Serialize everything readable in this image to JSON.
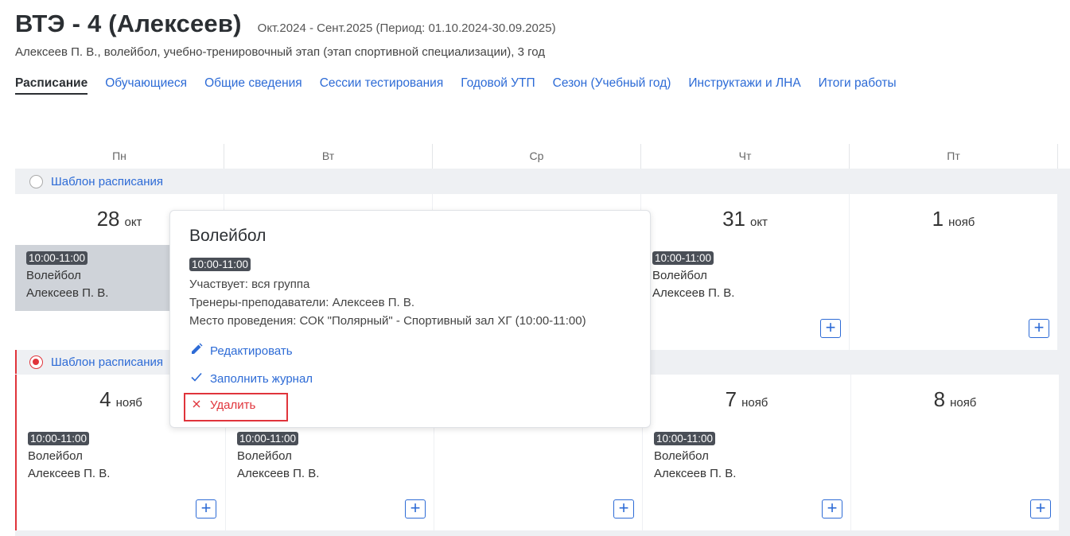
{
  "header": {
    "title": "ВТЭ - 4 (Алексеев)",
    "period": "Окт.2024 - Сент.2025 (Период: 01.10.2024-30.09.2025)",
    "subtitle": "Алексеев П. В., волейбол, учебно-тренировочный этап (этап спортивной специализации), 3 год"
  },
  "tabs": [
    {
      "label": "Расписание",
      "active": true
    },
    {
      "label": "Обучающиеся"
    },
    {
      "label": "Общие сведения"
    },
    {
      "label": "Сессии тестирования"
    },
    {
      "label": "Годовой УТП"
    },
    {
      "label": "Сезон (Учебный год)"
    },
    {
      "label": "Инструктажи и ЛНА"
    },
    {
      "label": "Итоги работы"
    }
  ],
  "calendar": {
    "days_of_week": [
      "Пн",
      "Вт",
      "Ср",
      "Чт",
      "Пт"
    ],
    "weeks": [
      {
        "template_label": "Шаблон расписания",
        "days": [
          {
            "num": "28",
            "mon": "окт",
            "event": {
              "time": "10:00-11:00",
              "title": "Волейбол",
              "coach": "Алексеев П. В."
            }
          },
          {
            "num": "",
            "mon": ""
          },
          {
            "num": "",
            "mon": ""
          },
          {
            "num": "31",
            "mon": "окт",
            "event": {
              "time": "10:00-11:00",
              "title": "Волейбол",
              "coach": "Алексеев П. В."
            }
          },
          {
            "num": "1",
            "mon": "нояб"
          }
        ]
      },
      {
        "template_label": "Шаблон расписания",
        "days": [
          {
            "num": "4",
            "mon": "нояб",
            "event": {
              "time": "10:00-11:00",
              "title": "Волейбол",
              "coach": "Алексеев П. В."
            }
          },
          {
            "num": "",
            "mon": "",
            "event": {
              "time": "10:00-11:00",
              "title": "Волейбол",
              "coach": "Алексеев П. В."
            }
          },
          {
            "num": "",
            "mon": ""
          },
          {
            "num": "7",
            "mon": "нояб",
            "event": {
              "time": "10:00-11:00",
              "title": "Волейбол",
              "coach": "Алексеев П. В."
            }
          },
          {
            "num": "8",
            "mon": "нояб"
          }
        ]
      }
    ],
    "add_symbol": "+"
  },
  "popup": {
    "title": "Волейбол",
    "time": "10:00-11:00",
    "participants": "Участвует: вся группа",
    "coaches": "Тренеры-преподаватели: Алексеев П. В.",
    "location": "Место проведения: СОК \"Полярный\" - Спортивный зал ХГ (10:00-11:00)",
    "edit_label": "Редактировать",
    "fill_label": "Заполнить журнал",
    "delete_label": "Удалить"
  },
  "colors": {
    "accent": "#2d6bd6",
    "danger": "#e0343b",
    "badge": "#4a4f57"
  }
}
